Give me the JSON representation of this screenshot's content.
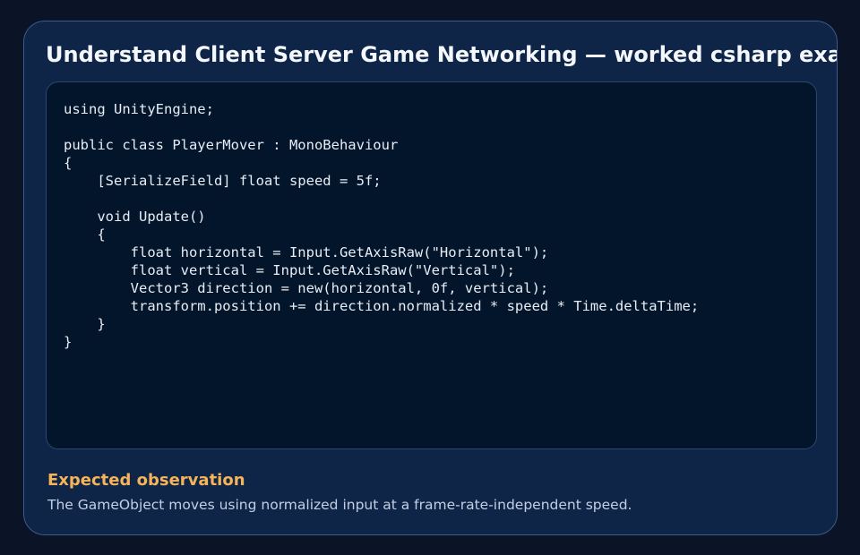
{
  "card": {
    "title": "Understand Client Server Game Networking — worked csharp example"
  },
  "code": {
    "language": "csharp",
    "text": "using UnityEngine;\n\npublic class PlayerMover : MonoBehaviour\n{\n    [SerializeField] float speed = 5f;\n\n    void Update()\n    {\n        float horizontal = Input.GetAxisRaw(\"Horizontal\");\n        float vertical = Input.GetAxisRaw(\"Vertical\");\n        Vector3 direction = new(horizontal, 0f, vertical);\n        transform.position += direction.normalized * speed * Time.deltaTime;\n    }\n}"
  },
  "observation": {
    "heading": "Expected observation",
    "text": "The GameObject moves using normalized input at a frame-rate-independent speed."
  },
  "colors": {
    "page_background": "#0a1426",
    "card_background": "#0f2548",
    "card_border": "#3c5a8a",
    "code_background": "#03152b",
    "title_text": "#f4f7fb",
    "code_text": "#e8edf5",
    "heading_accent": "#f5b35a",
    "body_text": "#c2cfe3"
  }
}
